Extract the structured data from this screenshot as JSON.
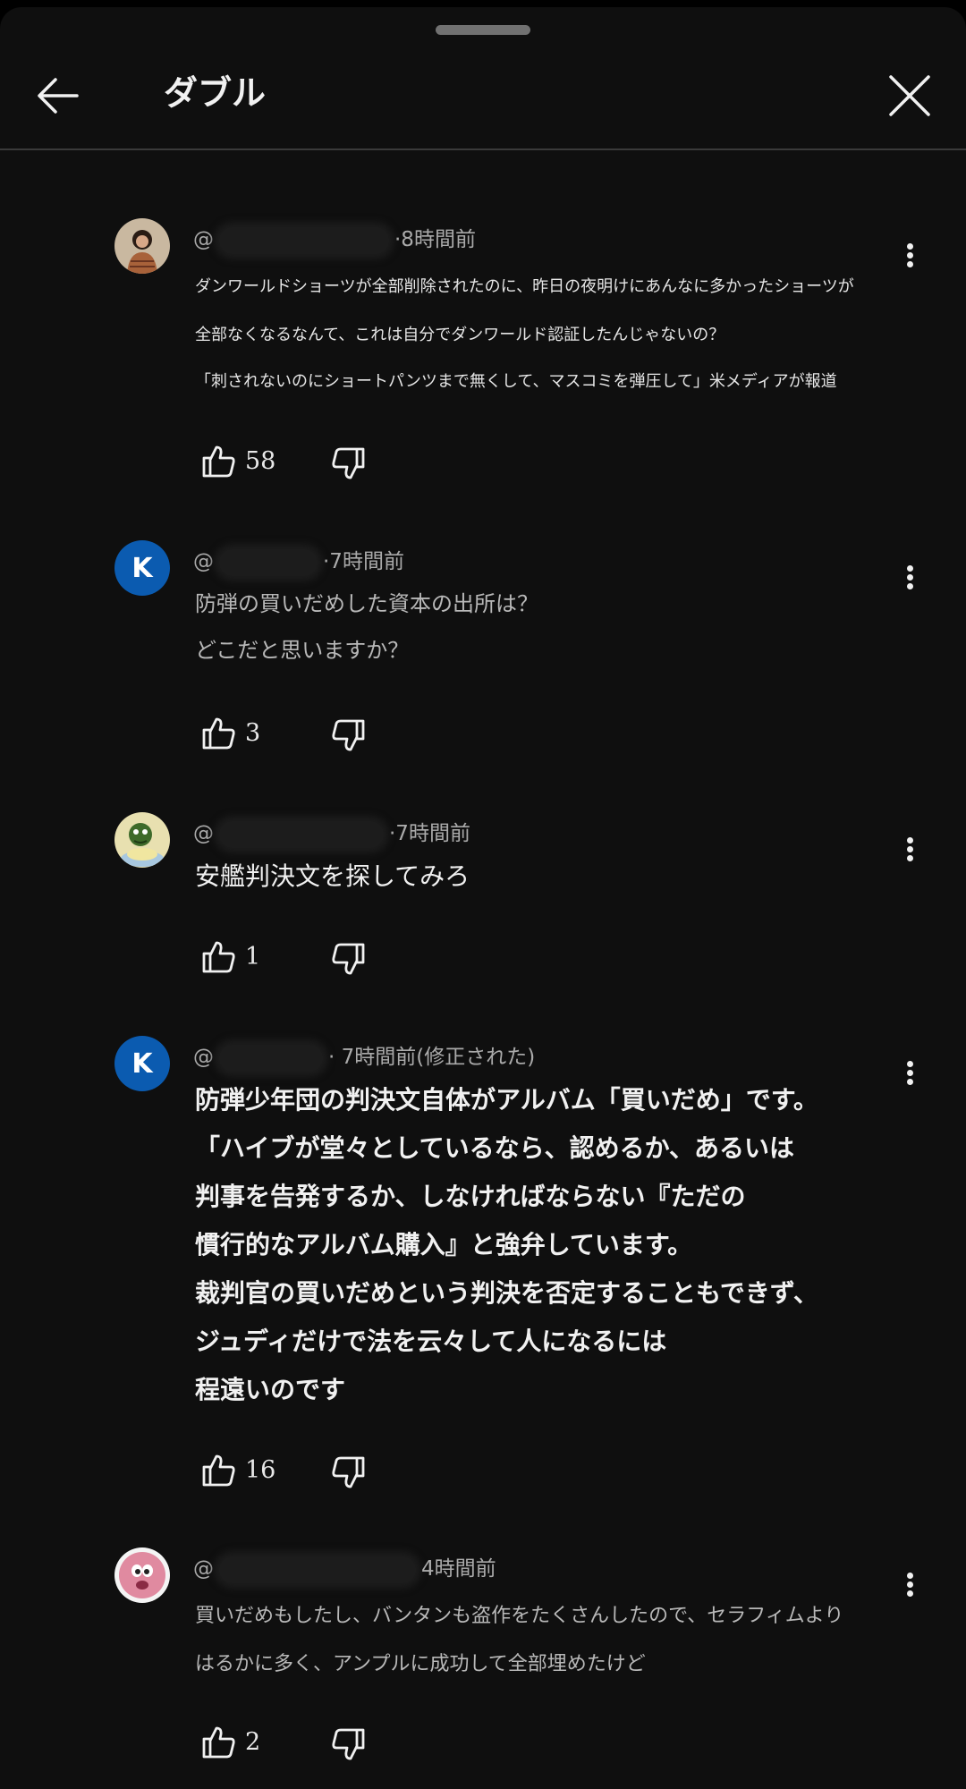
{
  "header": {
    "title": "ダブル"
  },
  "icons": {
    "back": "arrow-left-icon",
    "close": "close-icon",
    "like": "thumb-up-icon",
    "dislike": "thumb-down-icon",
    "more": "more-vert-icon"
  },
  "colors": {
    "background": "#0f0f0f",
    "avatar_k": "#0b5bb0",
    "text_primary": "#f1f1f1",
    "text_secondary": "#aaaaaa"
  },
  "comments": [
    {
      "at": "@",
      "time": "·8時間前",
      "avatar_letter": "",
      "lines": [
        "ダンワールドショーツが全部削除されたのに、昨日の夜明けにあんなに多かったショーツが",
        "全部なくなるなんて、これは自分でダンワールド認証したんじゃないの？",
        "「刺されないのにショートパンツまで無くして、マスコミを弾圧して」米メディアが報道"
      ],
      "likes": "58"
    },
    {
      "at": "@",
      "time": "·7時間前",
      "avatar_letter": "K",
      "lines": [
        "防弾の買いだめした資本の出所は？",
        "どこだと思いますか？"
      ],
      "likes": "3"
    },
    {
      "at": "@",
      "time": "·7時間前",
      "avatar_letter": "",
      "lines": [
        "安艦判決文を探してみろ"
      ],
      "likes": "1"
    },
    {
      "at": "@",
      "time": "· 7時間前(修正された)",
      "avatar_letter": "K",
      "lines": [
        "防弾少年団の判決文自体がアルバム「買いだめ」です。",
        "「ハイブが堂々としているなら、認めるか、あるいは",
        "判事を告発するか、しなければならない『ただの",
        "慣行的なアルバム購入』と強弁しています。",
        "裁判官の買いだめという判決を否定することもできず、",
        "ジュディだけで法を云々して人になるには",
        "程遠いのです"
      ],
      "likes": "16"
    },
    {
      "at": "@",
      "time": "4時間前",
      "avatar_letter": "",
      "lines": [
        "買いだめもしたし、バンタンも盗作をたくさんしたので、セラフィムより",
        "はるかに多く、アンプルに成功して全部埋めたけど"
      ],
      "likes": "2"
    }
  ]
}
